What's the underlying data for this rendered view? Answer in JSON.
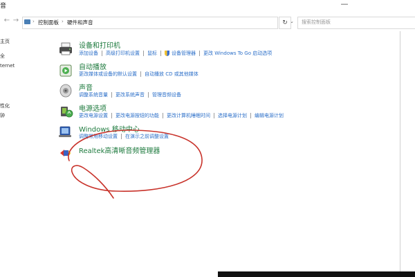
{
  "window": {
    "title": "音",
    "minimize_glyph": "—"
  },
  "address": {
    "back_glyph": "←",
    "forward_glyph": "→",
    "crumb_sep": "›",
    "crumbs": [
      "控制面板",
      "硬件和声音"
    ],
    "dropdown_glyph": "⌄",
    "refresh_glyph": "↻"
  },
  "search": {
    "placeholder": "搜索控制面板"
  },
  "sidebar": {
    "items": [
      "主页",
      "全",
      "ternet",
      "",
      "性化",
      "钟"
    ]
  },
  "categories": [
    {
      "title": "设备和打印机",
      "icon": "printer-icon",
      "links": [
        "添加设备",
        "高级打印机设置",
        "鼠标",
        "设备管理器",
        "更改 Windows To Go 启动选项"
      ]
    },
    {
      "title": "自动播放",
      "icon": "autoplay-icon",
      "links": [
        "更改媒体或设备的默认设置",
        "自动播放 CD 或其他媒体"
      ]
    },
    {
      "title": "声音",
      "icon": "speaker-icon",
      "links": [
        "调整系统音量",
        "更改系统声音",
        "管理音频设备"
      ]
    },
    {
      "title": "电源选项",
      "icon": "power-icon",
      "links": [
        "更改电源设置",
        "更改电源按钮的功能",
        "更改计算机睡眠时间",
        "选择电源计划",
        "编辑电源计划"
      ]
    },
    {
      "title": "Windows 移动中心",
      "icon": "mobility-center-icon",
      "links": [
        "调整常用移动设置",
        "在演示之前调整设置"
      ]
    },
    {
      "title": "Realtek高清晰音频管理器",
      "icon": "realtek-icon",
      "links": []
    }
  ],
  "colors": {
    "title_green": "#1e7a3e",
    "link_blue": "#2a6ec8",
    "annotation_red": "#c8322a"
  }
}
